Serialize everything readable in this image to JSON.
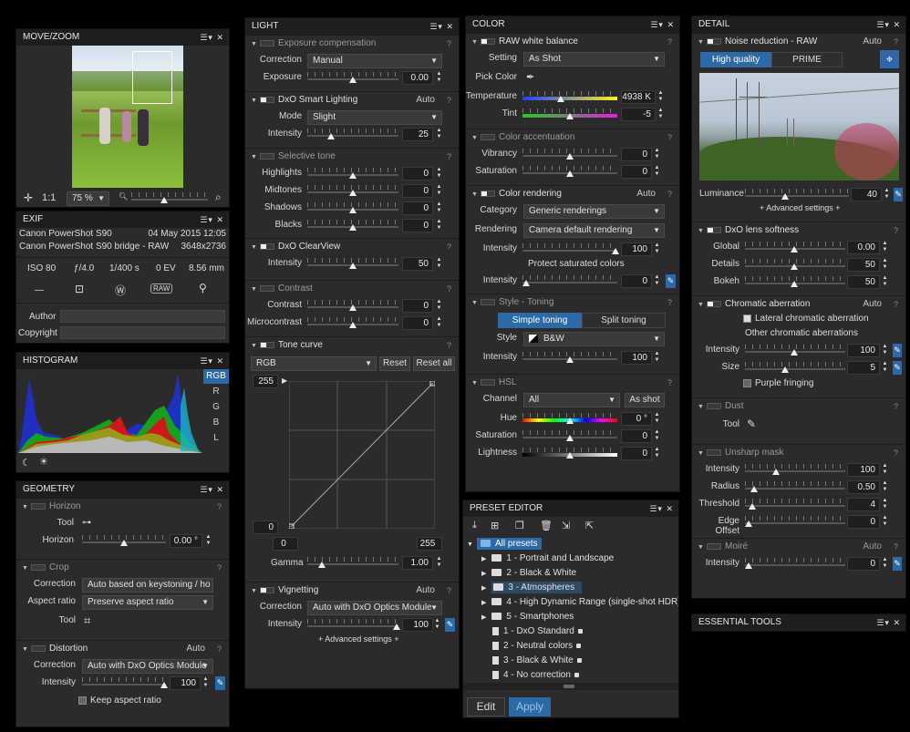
{
  "move_zoom": {
    "title": "MOVE/ZOOM",
    "ratio": "1:1",
    "zoom": "75 %"
  },
  "exif": {
    "title": "EXIF",
    "camera": "Canon PowerShot S90",
    "date": "04 May 2015 12:05",
    "bridge": "Canon PowerShot S90 bridge - RAW",
    "size": "3648x2736",
    "iso": "ISO 80",
    "aperture": "ƒ/4.0",
    "shutter": "1/400 s",
    "ev": "0 EV",
    "focal": "8.56 mm",
    "dash": "—",
    "author_label": "Author",
    "copyright_label": "Copyright"
  },
  "histogram": {
    "title": "HISTOGRAM",
    "channels": [
      "RGB",
      "R",
      "G",
      "B",
      "L"
    ]
  },
  "geometry": {
    "title": "GEOMETRY",
    "horizon": {
      "label": "Horizon",
      "tool": "Tool",
      "horizon_label": "Horizon",
      "value": "0.00 °"
    },
    "crop": {
      "label": "Crop",
      "correction_label": "Correction",
      "correction": "Auto based on keystoning / ho",
      "ratio_label": "Aspect ratio",
      "ratio": "Preserve aspect ratio",
      "tool": "Tool"
    },
    "distortion": {
      "label": "Distortion",
      "auto": "Auto",
      "correction_label": "Correction",
      "correction": "Auto with DxO Optics Module",
      "intensity_label": "Intensity",
      "intensity": "100",
      "keep": "Keep aspect ratio"
    }
  },
  "light": {
    "title": "LIGHT",
    "exposure": {
      "label": "Exposure compensation",
      "correction_label": "Correction",
      "correction": "Manual",
      "exposure_label": "Exposure",
      "exposure": "0.00"
    },
    "smart": {
      "label": "DxO Smart Lighting",
      "auto": "Auto",
      "mode_label": "Mode",
      "mode": "Slight",
      "intensity_label": "Intensity",
      "intensity": "25"
    },
    "selective": {
      "label": "Selective tone",
      "rows": [
        {
          "label": "Highlights",
          "value": "0"
        },
        {
          "label": "Midtones",
          "value": "0"
        },
        {
          "label": "Shadows",
          "value": "0"
        },
        {
          "label": "Blacks",
          "value": "0"
        }
      ]
    },
    "clearview": {
      "label": "DxO ClearView",
      "intensity_label": "Intensity",
      "intensity": "50"
    },
    "contrast": {
      "label": "Contrast",
      "rows": [
        {
          "label": "Contrast",
          "value": "0"
        },
        {
          "label": "Microcontrast",
          "value": "0"
        }
      ]
    },
    "tone": {
      "label": "Tone curve",
      "channel": "RGB",
      "reset": "Reset",
      "reset_all": "Reset all",
      "top_in": "255",
      "bottom_in": "0",
      "x_min": "0",
      "x_max": "255",
      "gamma_label": "Gamma",
      "gamma": "1.00"
    },
    "vignetting": {
      "label": "Vignetting",
      "auto": "Auto",
      "correction_label": "Correction",
      "correction": "Auto with DxO Optics Module",
      "intensity_label": "Intensity",
      "intensity": "100",
      "advanced": "+ Advanced settings +"
    }
  },
  "color": {
    "title": "COLOR",
    "wb": {
      "label": "RAW white balance",
      "setting_label": "Setting",
      "setting": "As Shot",
      "pick": "Pick Color",
      "temp_label": "Temperature",
      "temp": "4938 K",
      "tint_label": "Tint",
      "tint": "-5"
    },
    "accent": {
      "label": "Color accentuation",
      "rows": [
        {
          "label": "Vibrancy",
          "value": "0"
        },
        {
          "label": "Saturation",
          "value": "0"
        }
      ]
    },
    "rendering": {
      "label": "Color rendering",
      "auto": "Auto",
      "category_label": "Category",
      "category": "Generic renderings",
      "rendering_label": "Rendering",
      "rendering": "Camera default rendering",
      "intensity_label": "Intensity",
      "intensity": "100",
      "protect": "Protect saturated colors",
      "pintensity_label": "Intensity",
      "pintensity": "0"
    },
    "toning": {
      "label": "Style - Toning",
      "simple": "Simple toning",
      "split": "Split toning",
      "style_label": "Style",
      "style": "B&W",
      "intensity_label": "Intensity",
      "intensity": "100"
    },
    "hsl": {
      "label": "HSL",
      "channel_label": "Channel",
      "channel": "All",
      "as_shot": "As shot",
      "hue_label": "Hue",
      "hue": "0 °",
      "sat_label": "Saturation",
      "sat": "0",
      "light_label": "Lightness",
      "light": "0"
    }
  },
  "preset": {
    "title": "PRESET EDITOR",
    "root": "All presets",
    "folders": [
      "1 - Portrait and Landscape",
      "2 - Black & White",
      "3 - Atmospheres",
      "4 - High Dynamic Range (single-shot HDR)",
      "5 - Smartphones"
    ],
    "presets": [
      "1 - DxO Standard",
      "2 - Neutral colors",
      "3 - Black & White",
      "4 - No correction"
    ],
    "edit": "Edit",
    "apply": "Apply"
  },
  "detail": {
    "title": "DETAIL",
    "noise": {
      "label": "Noise reduction - RAW",
      "auto": "Auto",
      "hq": "High quality",
      "prime": "PRIME",
      "lum_label": "Luminance",
      "lum": "40",
      "advanced": "+ Advanced settings +"
    },
    "softness": {
      "label": "DxO lens softness",
      "rows": [
        {
          "label": "Global",
          "value": "0.00"
        },
        {
          "label": "Details",
          "value": "50"
        },
        {
          "label": "Bokeh",
          "value": "50"
        }
      ]
    },
    "chroma": {
      "label": "Chromatic aberration",
      "auto": "Auto",
      "lateral": "Lateral chromatic aberration",
      "other": "Other chromatic aberrations",
      "intensity_label": "Intensity",
      "intensity": "100",
      "size_label": "Size",
      "size": "5",
      "purple": "Purple fringing"
    },
    "dust": {
      "label": "Dust",
      "tool": "Tool"
    },
    "unsharp": {
      "label": "Unsharp mask",
      "rows": [
        {
          "label": "Intensity",
          "value": "100"
        },
        {
          "label": "Radius",
          "value": "0.50"
        },
        {
          "label": "Threshold",
          "value": "4"
        },
        {
          "label": "Edge Offset",
          "value": "0"
        }
      ]
    },
    "moire": {
      "label": "Moiré",
      "auto": "Auto",
      "intensity_label": "Intensity",
      "intensity": "0"
    }
  },
  "essential": {
    "title": "ESSENTIAL TOOLS"
  }
}
